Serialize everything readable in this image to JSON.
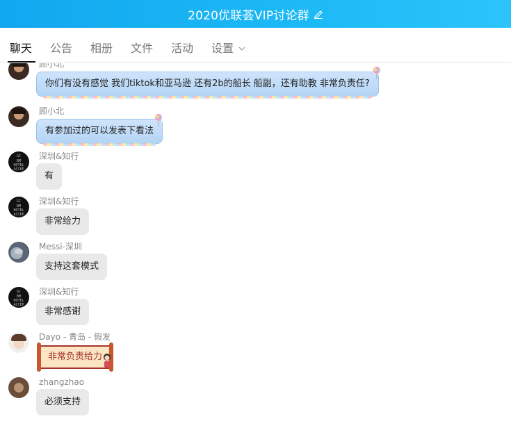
{
  "header": {
    "title": "2020优联荟VIP讨论群",
    "edit_icon": "edit-icon"
  },
  "tabs": [
    {
      "label": "聊天",
      "active": true
    },
    {
      "label": "公告"
    },
    {
      "label": "相册"
    },
    {
      "label": "文件"
    },
    {
      "label": "活动"
    },
    {
      "label": "设置",
      "has_dropdown": true
    }
  ],
  "messages": [
    {
      "sender": "顾小北",
      "text": "你们有没有感觉 我们tiktok和亚马逊 还有2b的船长 船副，还有助教 非常负责任?",
      "bubble_style": "blue",
      "avatar": "photo-man"
    },
    {
      "sender": "顾小北",
      "text": "有参加过的可以发表下看法",
      "bubble_style": "blue",
      "avatar": "photo-man"
    },
    {
      "sender": "深圳&知行",
      "text": "有",
      "bubble_style": "gray",
      "avatar": "black-logo"
    },
    {
      "sender": "深圳&知行",
      "text": "非常给力",
      "bubble_style": "gray",
      "avatar": "black-logo"
    },
    {
      "sender": "Messi-深圳",
      "text": "支持这套模式",
      "bubble_style": "gray",
      "avatar": "cat"
    },
    {
      "sender": "深圳&知行",
      "text": "非常感谢",
      "bubble_style": "gray",
      "avatar": "black-logo"
    },
    {
      "sender": "Dayo - 青岛 - 假发",
      "text": "非常负责给力",
      "bubble_style": "scroll",
      "avatar": "girl"
    },
    {
      "sender": "zhangzhao",
      "text": "必须支持",
      "bubble_style": "gray",
      "avatar": "kid"
    }
  ],
  "avatar_logo_text": [
    "GC",
    "BM",
    "HOTEL",
    "ACCEP"
  ],
  "colors": {
    "header_start": "#12a7ef",
    "header_end": "#2cc4fb",
    "blue_bubble": "#b3d4f5",
    "gray_bubble": "#e9e9e9",
    "scroll_border": "#a5342c"
  }
}
